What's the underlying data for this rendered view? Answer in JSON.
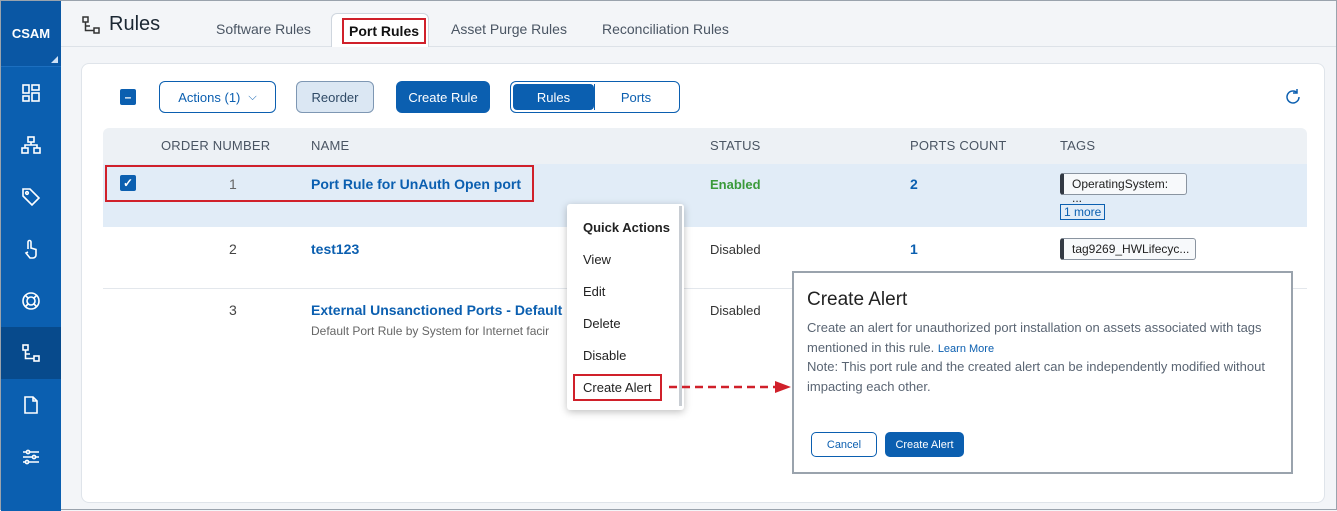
{
  "app": {
    "logo": "CSAM"
  },
  "header": {
    "title": "Rules",
    "tabs": [
      {
        "label": "Software Rules"
      },
      {
        "label": "Port Rules"
      },
      {
        "label": "Asset Purge Rules"
      },
      {
        "label": "Reconciliation Rules"
      }
    ]
  },
  "toolbar": {
    "actions_label": "Actions (1)",
    "reorder_label": "Reorder",
    "create_rule_label": "Create Rule",
    "toggle_rules": "Rules",
    "toggle_ports": "Ports"
  },
  "table": {
    "headers": [
      "ORDER NUMBER",
      "NAME",
      "STATUS",
      "PORTS COUNT",
      "TAGS"
    ],
    "rows": [
      {
        "order": "1",
        "name": "Port Rule for UnAuth Open port",
        "status": "Enabled",
        "ports": "2",
        "tag": "OperatingSystem: ...",
        "more": "1 more"
      },
      {
        "order": "2",
        "name": "test123",
        "status": "Disabled",
        "ports": "1",
        "tag": "tag9269_HWLifecyc..."
      },
      {
        "order": "3",
        "name": "External Unsanctioned Ports - Default",
        "desc": "Default Port Rule by System for Internet facir",
        "status": "Disabled"
      }
    ]
  },
  "menu": {
    "title": "Quick Actions",
    "items": [
      "View",
      "Edit",
      "Delete",
      "Disable",
      "Create Alert"
    ]
  },
  "alert": {
    "title": "Create Alert",
    "desc": "Create an alert for unauthorized port installation on assets associated with tags mentioned in this rule.",
    "learn_more": "Learn More",
    "note": "Note: This port rule and the created alert can be independently modified without impacting each other.",
    "cancel": "Cancel",
    "create": "Create Alert"
  },
  "colors": {
    "primary": "#0b5fb0",
    "enabled": "#3a9a3a",
    "highlight": "#d0202a"
  }
}
